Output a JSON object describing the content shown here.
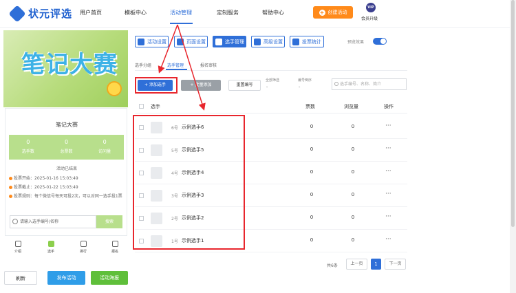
{
  "brand": {
    "name": "状元评选"
  },
  "nav": {
    "items": [
      "用户首页",
      "模板中心",
      "活动管理",
      "定制服务",
      "帮助中心"
    ],
    "active_index": 2,
    "create_label": "创建活动",
    "vip_badge": "VIP",
    "vip_label": "会员升级"
  },
  "preview": {
    "banner_title": "笔记大赛",
    "card_title": "笔记大赛",
    "stats": [
      {
        "value": "0",
        "label": "选手数"
      },
      {
        "value": "0",
        "label": "总票数"
      },
      {
        "value": "0",
        "label": "访问量"
      }
    ],
    "status": "活动已结束",
    "rules": [
      "投票开始：2025-01-16 15:03:49",
      "投票截止：2025-01-22 15:03:49",
      "投票规则：每个微信号每天可投2次，可以对同一选手投1票"
    ],
    "search_placeholder": "请输入选手编号/名称",
    "search_button": "搜索",
    "bottom_nav": [
      "介绍",
      "选手",
      "排行",
      "报名"
    ],
    "bottom_nav_active": 1,
    "actions": [
      "刷新",
      "发布活动",
      "活动海报"
    ]
  },
  "toolbar": {
    "tabs": [
      "活动设置",
      "页面设置",
      "选手管理",
      "高级设置",
      "投票统计"
    ],
    "active_index": 2,
    "preview_label": "预览效果",
    "preview_on": true
  },
  "subtabs": {
    "items": [
      "选手分组",
      "选手管理",
      "报名审核"
    ],
    "active_index": 1
  },
  "actions": {
    "add_label": "+ 添加选手",
    "batch_label": "+ 批量添加",
    "reset_label": "重置编号",
    "filter_all": "全部筛选",
    "sort_label": "编号倒序",
    "search_placeholder": "选手编号、名称、简介"
  },
  "table": {
    "headers": [
      "选手",
      "票数",
      "浏览量",
      "操作"
    ],
    "rows": [
      {
        "num": "6号",
        "name": "示例选手6",
        "votes": "0",
        "views": "0",
        "op": "···"
      },
      {
        "num": "5号",
        "name": "示例选手5",
        "votes": "0",
        "views": "0",
        "op": "···"
      },
      {
        "num": "4号",
        "name": "示例选手4",
        "votes": "0",
        "views": "0",
        "op": "···"
      },
      {
        "num": "3号",
        "name": "示例选手3",
        "votes": "0",
        "views": "0",
        "op": "···"
      },
      {
        "num": "2号",
        "name": "示例选手2",
        "votes": "0",
        "views": "0",
        "op": "···"
      },
      {
        "num": "1号",
        "name": "示例选手1",
        "votes": "0",
        "views": "0",
        "op": "···"
      }
    ]
  },
  "pagination": {
    "total": "共6条",
    "prev": "上一页",
    "current": "1",
    "next": "下一页"
  },
  "colors": {
    "primary": "#2f6fd8",
    "accent": "#ff8a1a",
    "green": "#8ccf4d",
    "annotation": "#e8262d"
  }
}
